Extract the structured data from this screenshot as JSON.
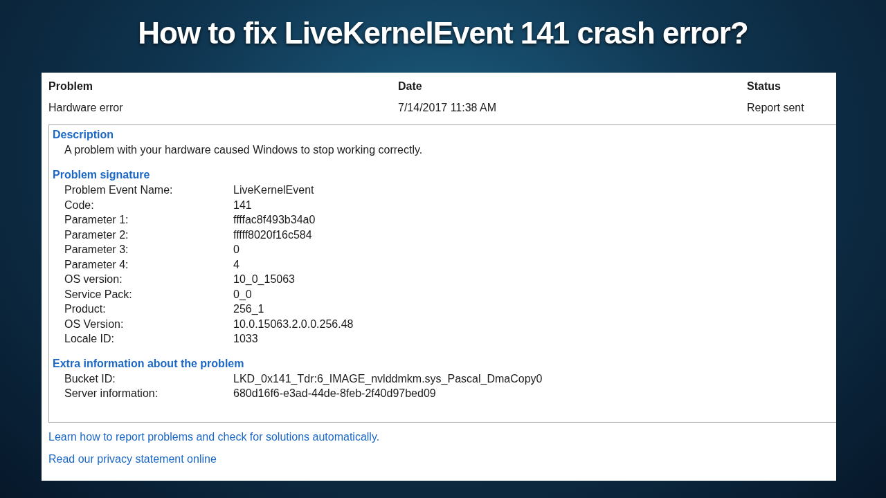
{
  "title": "How to fix LiveKernelEvent 141 crash error?",
  "columns": [
    {
      "heading": "Problem",
      "value": "Hardware error"
    },
    {
      "heading": "Date",
      "value": "7/14/2017 11:38 AM"
    },
    {
      "heading": "Status",
      "value": "Report sent"
    }
  ],
  "sections": [
    {
      "kind": "text",
      "heading": "Description",
      "text": "A problem with your hardware caused Windows to stop working correctly."
    },
    {
      "kind": "table",
      "heading": "Problem signature",
      "rows": [
        {
          "label": "Problem Event Name:",
          "value": "LiveKernelEvent"
        },
        {
          "label": "Code:",
          "value": "141"
        },
        {
          "label": "Parameter 1:",
          "value": "ffffac8f493b34a0"
        },
        {
          "label": "Parameter 2:",
          "value": "fffff8020f16c584"
        },
        {
          "label": "Parameter 3:",
          "value": "0"
        },
        {
          "label": "Parameter 4:",
          "value": "4"
        },
        {
          "label": "OS version:",
          "value": "10_0_15063"
        },
        {
          "label": "Service Pack:",
          "value": "0_0"
        },
        {
          "label": "Product:",
          "value": "256_1"
        },
        {
          "label": "OS Version:",
          "value": "10.0.15063.2.0.0.256.48"
        },
        {
          "label": "Locale ID:",
          "value": "1033"
        }
      ]
    },
    {
      "kind": "table",
      "heading": "Extra information about the problem",
      "rows": [
        {
          "label": "Bucket ID:",
          "value": "LKD_0x141_Tdr:6_IMAGE_nvlddmkm.sys_Pascal_DmaCopy0"
        },
        {
          "label": "Server information:",
          "value": "680d16f6-e3ad-44de-8feb-2f40d97bed09"
        }
      ]
    }
  ],
  "links": [
    "Learn how to report problems and check for solutions automatically.",
    "Read our privacy statement online"
  ]
}
